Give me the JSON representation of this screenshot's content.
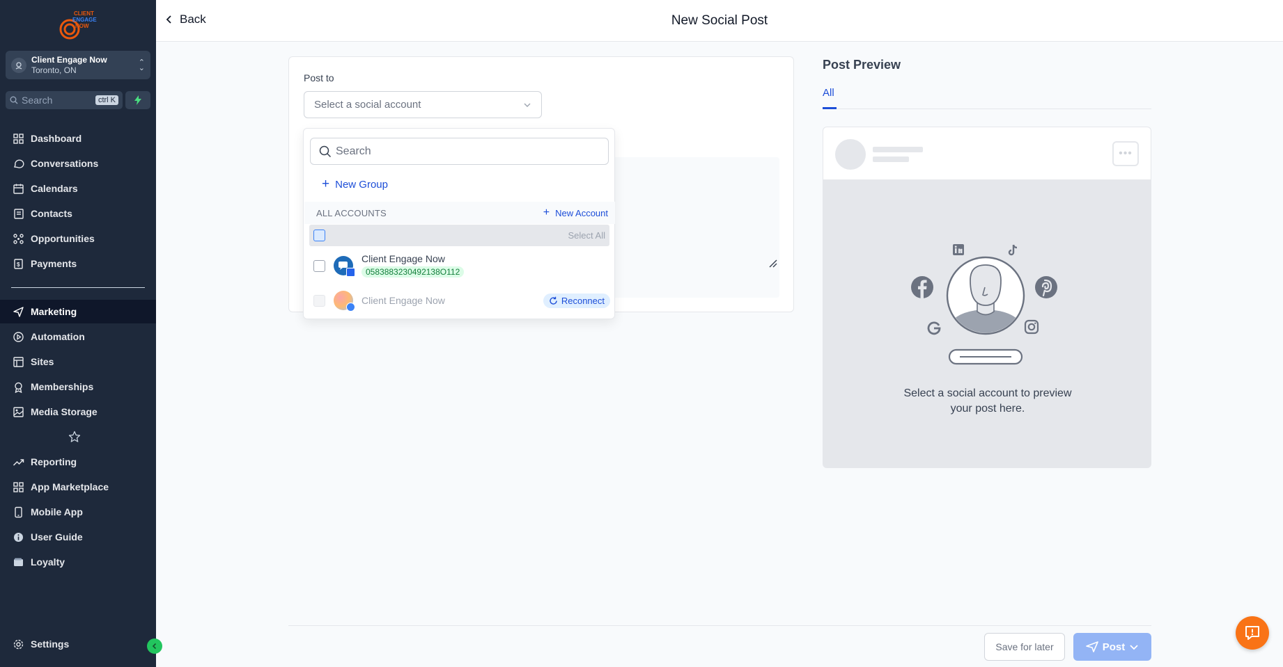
{
  "app": {
    "logo_text": "CLIENT ENGAGE NOW"
  },
  "sidebar": {
    "account": {
      "name": "Client Engage Now",
      "location": "Toronto, ON"
    },
    "search": {
      "placeholder": "Search",
      "shortcut": "ctrl K"
    },
    "items": [
      {
        "label": "Dashboard",
        "icon": "dashboard-icon"
      },
      {
        "label": "Conversations",
        "icon": "chat-icon"
      },
      {
        "label": "Calendars",
        "icon": "calendar-icon"
      },
      {
        "label": "Contacts",
        "icon": "contacts-icon"
      },
      {
        "label": "Opportunities",
        "icon": "opportunities-icon"
      },
      {
        "label": "Payments",
        "icon": "payments-icon"
      },
      {
        "label": "Marketing",
        "icon": "send-icon",
        "active": true
      },
      {
        "label": "Automation",
        "icon": "automation-icon"
      },
      {
        "label": "Sites",
        "icon": "sites-icon"
      },
      {
        "label": "Memberships",
        "icon": "memberships-icon"
      },
      {
        "label": "Media Storage",
        "icon": "image-icon"
      },
      {
        "label": "Reporting",
        "icon": "trend-icon"
      },
      {
        "label": "App Marketplace",
        "icon": "grid-icon"
      },
      {
        "label": "Mobile App",
        "icon": "mobile-icon"
      },
      {
        "label": "User Guide",
        "icon": "info-icon"
      },
      {
        "label": "Loyalty",
        "icon": "wallet-icon"
      }
    ],
    "settings_label": "Settings"
  },
  "header": {
    "back_label": "Back",
    "title": "New Social Post"
  },
  "composer": {
    "post_to_label": "Post to",
    "select_placeholder": "Select a social account"
  },
  "dropdown": {
    "search_placeholder": "Search",
    "new_group_label": "New Group",
    "all_accounts_label": "ALL ACCOUNTS",
    "new_account_label": "New Account",
    "select_all_label": "Select All",
    "accounts": [
      {
        "name": "Client Engage Now",
        "id": "0583883230492138O112",
        "status": "connected"
      },
      {
        "name": "Client Engage Now",
        "status": "disconnected",
        "action": "Reconnect"
      }
    ]
  },
  "preview": {
    "title": "Post Preview",
    "tab": "All",
    "empty_message": "Select a social account to preview your post here."
  },
  "footer": {
    "save_label": "Save for later",
    "post_label": "Post"
  },
  "colors": {
    "sidebar_bg": "#1e293b",
    "accent": "#1d4ed8",
    "post_button": "#93b4f5",
    "help_button": "#f97316",
    "collapse_button": "#22c55e"
  }
}
